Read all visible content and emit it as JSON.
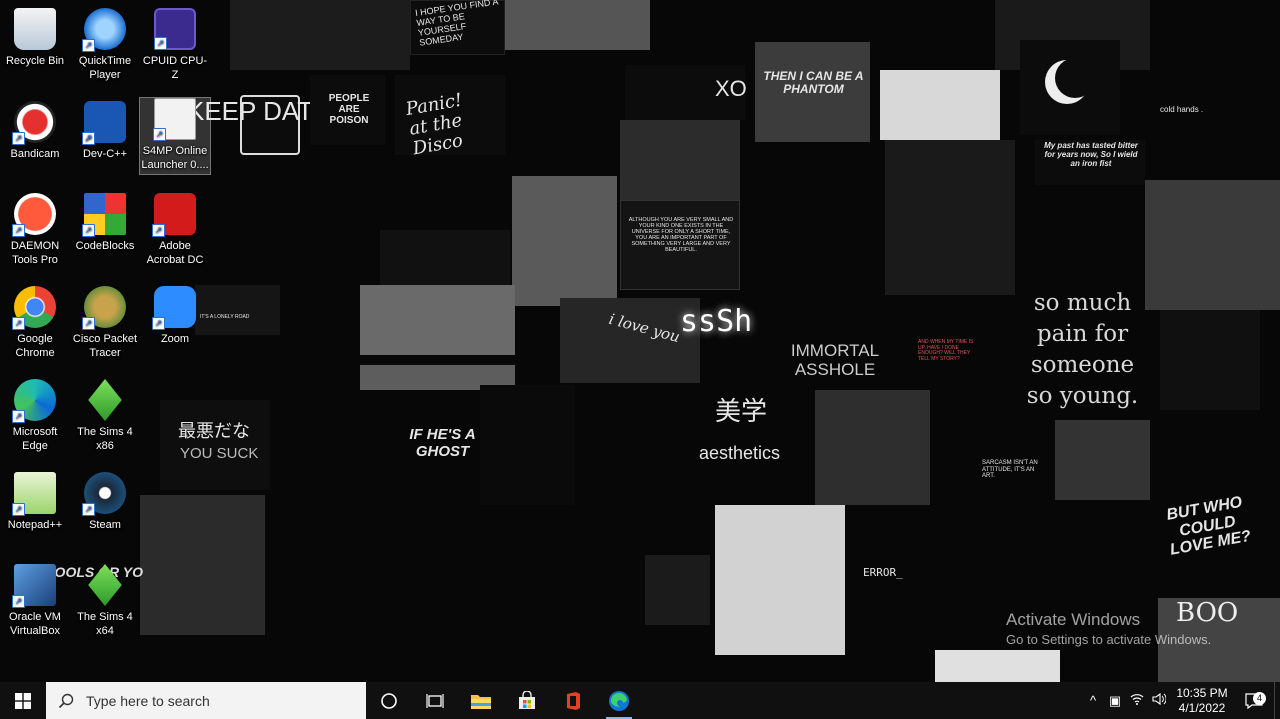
{
  "wallpaper": {
    "texts": {
      "hope": "I HOPE YOU FIND A WAY TO BE YOURSELF SOMEDAY",
      "keep": "KEEP DATE",
      "people": "PEOPLE ARE POISON",
      "panic": "Panic! at the Disco",
      "xo": "XO",
      "phantom": "THEN I CAN BE A PHANTOM",
      "cold": "cold hands .",
      "tasted": "My past has tasted bitter for years now, So I wield an iron fist",
      "although": "ALTHOUGH YOU ARE VERY SMALL AND YOUR KIND ONE EXISTS IN THE UNIVERSE FOR ONLY A SHORT TIME, YOU ARE AN IMPORTANT PART OF SOMETHING VERY LARGE AND VERY BEAUTIFUL.",
      "lonely": "IT'S A LONELY ROAD",
      "iloveyou": "i love you",
      "sssh": "ssSh",
      "immortal": "IMMORTAL ASSHOLE",
      "whenmytime": "AND WHEN MY TIME IS UP, HAVE I DONE ENOUGH? WILL THEY TELL MY STORY?",
      "somuch": "so much pain for someone so young.",
      "jp": "最悪だな",
      "yousuck": "YOU SUCK",
      "ifhes": "IF HE'S A GHOST",
      "bigaku": "美学",
      "aesthetics": "aesthetics",
      "sarcasm": "SARCASM ISN'T AN ATTITUDE, IT'S AN ART.",
      "butwho": "BUT WHO COULD LOVE ME?",
      "error": "ERROR_",
      "fools": "FOOLS OR YO",
      "boo": "BOO"
    }
  },
  "desktop_icons": [
    {
      "label": "Recycle Bin",
      "icon": "recycle-bin-icon"
    },
    {
      "label": "QuickTime Player",
      "icon": "quicktime-icon"
    },
    {
      "label": "CPUID CPU-Z",
      "icon": "cpuz-icon"
    },
    {
      "label": "Bandicam",
      "icon": "bandicam-icon"
    },
    {
      "label": "Dev-C++",
      "icon": "devcpp-icon"
    },
    {
      "label": "S4MP Online Launcher 0....",
      "icon": "s4mp-icon"
    },
    {
      "label": "DAEMON Tools Pro",
      "icon": "daemon-tools-icon"
    },
    {
      "label": "CodeBlocks",
      "icon": "codeblocks-icon"
    },
    {
      "label": "Adobe Acrobat DC",
      "icon": "acrobat-icon"
    },
    {
      "label": "Google Chrome",
      "icon": "chrome-icon"
    },
    {
      "label": "Cisco Packet Tracer",
      "icon": "packet-tracer-icon"
    },
    {
      "label": "Zoom",
      "icon": "zoom-icon"
    },
    {
      "label": "Microsoft Edge",
      "icon": "edge-icon"
    },
    {
      "label": "The Sims 4 x86",
      "icon": "sims4-icon"
    },
    {
      "label": "Notepad++",
      "icon": "notepadpp-icon"
    },
    {
      "label": "Steam",
      "icon": "steam-icon"
    },
    {
      "label": "Oracle VM VirtualBox",
      "icon": "virtualbox-icon"
    },
    {
      "label": "The Sims 4 x64",
      "icon": "sims4-icon"
    }
  ],
  "watermark": {
    "line1": "Activate Windows",
    "line2": "Go to Settings to activate Windows."
  },
  "taskbar": {
    "search_placeholder": "Type here to search",
    "pinned": [
      "task-view-icon",
      "file-explorer-icon",
      "microsoft-store-icon",
      "office-icon",
      "edge-icon"
    ],
    "clock_time": "10:35 PM",
    "clock_date": "4/1/2022",
    "notification_count": "4"
  },
  "colors": {
    "taskbar_bg": "#101010",
    "search_bg": "#f3f3f3",
    "accent": "#8ab4f8"
  }
}
